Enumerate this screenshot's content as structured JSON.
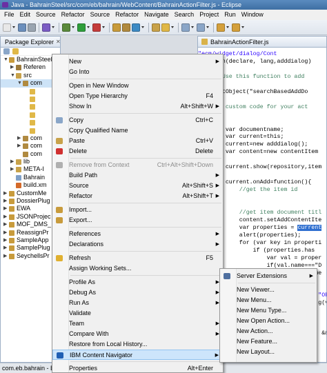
{
  "window": {
    "title": "Java - BahrainSteel/src/com/eb/bahrain/WebContent/BahrainActionFilter.js - Eclipse"
  },
  "menubar": [
    "File",
    "Edit",
    "Source",
    "Refactor",
    "Source",
    "Refactor",
    "Navigate",
    "Search",
    "Project",
    "Run",
    "Window"
  ],
  "package_explorer": {
    "tab_label": "Package Explorer",
    "rows": [
      {
        "label": "BahrainSteel",
        "expander": "▼",
        "level": 1,
        "icon_color": "#c89b3c"
      },
      {
        "label": "Referen",
        "expander": "▶",
        "level": 2,
        "icon_color": "#9c7a3c"
      },
      {
        "label": "src",
        "expander": "▼",
        "level": 2,
        "icon_color": "#c8a24a"
      },
      {
        "label": "com",
        "expander": "▼",
        "level": 3,
        "icon_color": "#b08a40",
        "selected": true
      },
      {
        "label": "",
        "expander": "",
        "level": 4,
        "icon_color": "#e0b848"
      },
      {
        "label": "",
        "expander": "",
        "level": 4,
        "icon_color": "#e0b848"
      },
      {
        "label": "",
        "expander": "",
        "level": 4,
        "icon_color": "#e0b848"
      },
      {
        "label": "",
        "expander": "",
        "level": 4,
        "icon_color": "#e0b848"
      },
      {
        "label": "",
        "expander": "",
        "level": 4,
        "icon_color": "#e0b848"
      },
      {
        "label": "",
        "expander": "",
        "level": 4,
        "icon_color": "#e0b848"
      },
      {
        "label": "com",
        "expander": "▶",
        "level": 3,
        "icon_color": "#b08a40"
      },
      {
        "label": "com",
        "expander": "▶",
        "level": 3,
        "icon_color": "#b08a40"
      },
      {
        "label": "com",
        "expander": "",
        "level": 3,
        "icon_color": "#b08a40"
      },
      {
        "label": "lib",
        "expander": "▶",
        "level": 2,
        "icon_color": "#c8a24a"
      },
      {
        "label": "META-I",
        "expander": "▶",
        "level": 2,
        "icon_color": "#c8a24a"
      },
      {
        "label": "Bahrain",
        "expander": "",
        "level": 2,
        "icon_color": "#7fa0c8"
      },
      {
        "label": "build.xm",
        "expander": "",
        "level": 2,
        "icon_color": "#d46a2a"
      },
      {
        "label": "CustomMe",
        "expander": "▶",
        "level": 1,
        "icon_color": "#c89b3c"
      },
      {
        "label": "DossierPlug",
        "expander": "▶",
        "level": 1,
        "icon_color": "#c89b3c"
      },
      {
        "label": "EWA",
        "expander": "▶",
        "level": 1,
        "icon_color": "#c89b3c"
      },
      {
        "label": "JSONProjec",
        "expander": "▶",
        "level": 1,
        "icon_color": "#c89b3c"
      },
      {
        "label": "MOF_DMS_",
        "expander": "▶",
        "level": 1,
        "icon_color": "#c89b3c"
      },
      {
        "label": "ReassignPr",
        "expander": "▶",
        "level": 1,
        "icon_color": "#c89b3c"
      },
      {
        "label": "SampleApp",
        "expander": "▶",
        "level": 1,
        "icon_color": "#c89b3c"
      },
      {
        "label": "SamplePlug",
        "expander": "▶",
        "level": 1,
        "icon_color": "#c89b3c"
      },
      {
        "label": "SeychellsPr",
        "expander": "▶",
        "level": 1,
        "icon_color": "#c89b3c"
      }
    ]
  },
  "editor": {
    "tab_label": "BahrainActionFilter.js",
    "lines": [
      {
        "cls": "c-str",
        "text": "\"ecm/widget/dialog/Cont"
      },
      {
        "cls": "",
        "text": "function(declare, lang,adddialog)"
      },
      {
        "cls": "c-com",
        "text": "    /**"
      },
      {
        "cls": "c-com",
        "text": "     * Use this function to add"
      },
      {
        "cls": "c-com",
        "text": "     */"
      },
      {
        "cls": "",
        "text": "lang.setObject(\"searchBasedAddDo"
      },
      {
        "cls": "c-com",
        "text": " /**"
      },
      {
        "cls": "c-com",
        "text": "  * Add custom code for your act"
      },
      {
        "cls": "c-com",
        "text": "  */"
      },
      {
        "cls": "",
        "text": ""
      },
      {
        "cls": "",
        "text": "        var documentname;"
      },
      {
        "cls": "",
        "text": "        var current=this;"
      },
      {
        "cls": "",
        "text": "        current=new adddialog();"
      },
      {
        "cls": "",
        "text": "        var content=new contentItem"
      },
      {
        "cls": "",
        "text": ""
      },
      {
        "cls": "",
        "text": "        current.show(repository,item"
      },
      {
        "cls": "",
        "text": ""
      },
      {
        "cls": "",
        "text": "        current.onAdd=function(){"
      },
      {
        "cls": "c-com",
        "text": "            //get the item id"
      },
      {
        "cls": "",
        "text": ""
      },
      {
        "cls": "",
        "text": ""
      },
      {
        "cls": "c-com",
        "text": "            //get item document titl"
      },
      {
        "cls": "",
        "text": "            content.setAddContentIte"
      },
      {
        "cls": "",
        "text": "            var properties = ",
        "hl": "current"
      },
      {
        "cls": "",
        "text": "            alert(properties);"
      },
      {
        "cls": "",
        "text": "            for (var key in properti"
      },
      {
        "cls": "",
        "text": "                if (properties.has"
      },
      {
        "cls": "",
        "text": "                    var val = proper"
      },
      {
        "cls": "",
        "text": "                    if(val.name===\"D"
      },
      {
        "cls": "",
        "text": "                        documentname"
      },
      {
        "cls": "",
        "text": ""
      },
      {
        "cls": "",
        "text": ""
      },
      {
        "cls": "c-str",
        "text": "                                   \"Ob"
      },
      {
        "cls": "",
        "text": "                                   g(va"
      },
      {
        "cls": "",
        "text": ""
      },
      {
        "cls": "",
        "text": ""
      },
      {
        "cls": "",
        "text": ""
      },
      {
        "cls": "",
        "text": "                                    &&"
      },
      {
        "cls": "",
        "text": ""
      },
      {
        "cls": "",
        "text": ""
      },
      {
        "cls": "",
        "text": ""
      },
      {
        "cls": "",
        "text": ""
      }
    ]
  },
  "context_menu": {
    "items": [
      {
        "type": "item",
        "label": "New",
        "shortcut": "",
        "arrow": true,
        "disabled": false,
        "icon": ""
      },
      {
        "type": "item",
        "label": "Go Into",
        "shortcut": "",
        "arrow": false,
        "disabled": false,
        "icon": ""
      },
      {
        "type": "sep"
      },
      {
        "type": "item",
        "label": "Open in New Window",
        "shortcut": "",
        "arrow": false,
        "disabled": false,
        "icon": ""
      },
      {
        "type": "item",
        "label": "Open Type Hierarchy",
        "shortcut": "F4",
        "arrow": false,
        "disabled": false,
        "icon": ""
      },
      {
        "type": "item",
        "label": "Show In",
        "shortcut": "Alt+Shift+W",
        "arrow": true,
        "disabled": false,
        "icon": ""
      },
      {
        "type": "sep"
      },
      {
        "type": "item",
        "label": "Copy",
        "shortcut": "Ctrl+C",
        "arrow": false,
        "disabled": false,
        "icon": "copy-icon"
      },
      {
        "type": "item",
        "label": "Copy Qualified Name",
        "shortcut": "",
        "arrow": false,
        "disabled": false,
        "icon": ""
      },
      {
        "type": "item",
        "label": "Paste",
        "shortcut": "Ctrl+V",
        "arrow": false,
        "disabled": false,
        "icon": "paste-icon"
      },
      {
        "type": "item",
        "label": "Delete",
        "shortcut": "Delete",
        "arrow": false,
        "disabled": false,
        "icon": "delete-icon"
      },
      {
        "type": "sep"
      },
      {
        "type": "item",
        "label": "Remove from Context",
        "shortcut": "Ctrl+Alt+Shift+Down",
        "arrow": false,
        "disabled": true,
        "icon": "remove-context-icon"
      },
      {
        "type": "item",
        "label": "Build Path",
        "shortcut": "",
        "arrow": true,
        "disabled": false,
        "icon": ""
      },
      {
        "type": "item",
        "label": "Source",
        "shortcut": "Alt+Shift+S",
        "arrow": true,
        "disabled": false,
        "icon": ""
      },
      {
        "type": "item",
        "label": "Refactor",
        "shortcut": "Alt+Shift+T",
        "arrow": true,
        "disabled": false,
        "icon": ""
      },
      {
        "type": "sep"
      },
      {
        "type": "item",
        "label": "Import...",
        "shortcut": "",
        "arrow": false,
        "disabled": false,
        "icon": "import-icon"
      },
      {
        "type": "item",
        "label": "Export...",
        "shortcut": "",
        "arrow": false,
        "disabled": false,
        "icon": "export-icon"
      },
      {
        "type": "sep"
      },
      {
        "type": "item",
        "label": "References",
        "shortcut": "",
        "arrow": true,
        "disabled": false,
        "icon": ""
      },
      {
        "type": "item",
        "label": "Declarations",
        "shortcut": "",
        "arrow": true,
        "disabled": false,
        "icon": ""
      },
      {
        "type": "sep"
      },
      {
        "type": "item",
        "label": "Refresh",
        "shortcut": "F5",
        "arrow": false,
        "disabled": false,
        "icon": "refresh-icon"
      },
      {
        "type": "item",
        "label": "Assign Working Sets...",
        "shortcut": "",
        "arrow": false,
        "disabled": false,
        "icon": ""
      },
      {
        "type": "sep"
      },
      {
        "type": "item",
        "label": "Profile As",
        "shortcut": "",
        "arrow": true,
        "disabled": false,
        "icon": ""
      },
      {
        "type": "item",
        "label": "Debug As",
        "shortcut": "",
        "arrow": true,
        "disabled": false,
        "icon": ""
      },
      {
        "type": "item",
        "label": "Run As",
        "shortcut": "",
        "arrow": true,
        "disabled": false,
        "icon": ""
      },
      {
        "type": "item",
        "label": "Validate",
        "shortcut": "",
        "arrow": false,
        "disabled": false,
        "icon": ""
      },
      {
        "type": "item",
        "label": "Team",
        "shortcut": "",
        "arrow": true,
        "disabled": false,
        "icon": ""
      },
      {
        "type": "item",
        "label": "Compare With",
        "shortcut": "",
        "arrow": true,
        "disabled": false,
        "icon": ""
      },
      {
        "type": "item",
        "label": "Restore from Local History...",
        "shortcut": "",
        "arrow": false,
        "disabled": false,
        "icon": ""
      },
      {
        "type": "item",
        "label": "IBM Content Navigator",
        "shortcut": "",
        "arrow": true,
        "disabled": false,
        "icon": "ibm-content-navigator-icon",
        "highlight": true
      },
      {
        "type": "sep"
      },
      {
        "type": "item",
        "label": "Properties",
        "shortcut": "Alt+Enter",
        "arrow": false,
        "disabled": false,
        "icon": ""
      }
    ]
  },
  "submenu": {
    "items": [
      {
        "type": "item",
        "label": "Server Extensions",
        "arrow": true,
        "icon": "server-extensions-icon"
      },
      {
        "type": "sep"
      },
      {
        "type": "item",
        "label": "New Viewer...",
        "arrow": false,
        "icon": ""
      },
      {
        "type": "item",
        "label": "New Menu...",
        "arrow": false,
        "icon": ""
      },
      {
        "type": "item",
        "label": "New Menu Type...",
        "arrow": false,
        "icon": ""
      },
      {
        "type": "item",
        "label": "New Open Action...",
        "arrow": false,
        "icon": ""
      },
      {
        "type": "item",
        "label": "New Action...",
        "arrow": false,
        "icon": ""
      },
      {
        "type": "item",
        "label": "New Feature...",
        "arrow": false,
        "icon": ""
      },
      {
        "type": "item",
        "label": "New Layout...",
        "arrow": false,
        "icon": ""
      }
    ]
  },
  "status": {
    "text": "com.eb.bahrain - Ba"
  }
}
